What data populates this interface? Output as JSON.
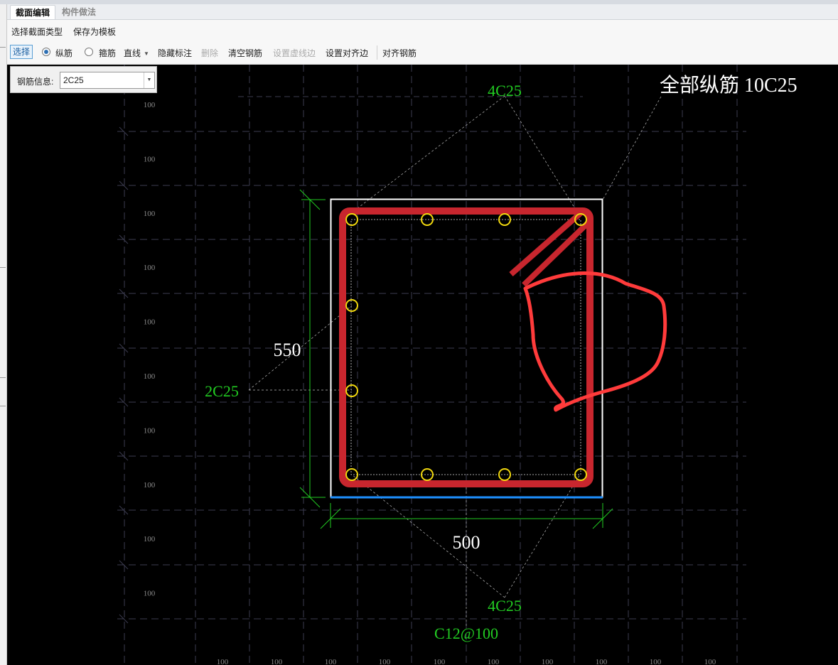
{
  "tabs": [
    {
      "label": "截面编辑",
      "active": true
    },
    {
      "label": "构件做法",
      "active": false
    }
  ],
  "menu": {
    "select_section_type": "选择截面类型",
    "save_as_template": "保存为模板"
  },
  "toolbar": {
    "select": "选择",
    "longitudinal": "纵筋",
    "stirrup": "箍筋",
    "mode": "直线",
    "hide_annotation": "隐藏标注",
    "delete": "删除",
    "clear_rebar": "清空钢筋",
    "set_dashed_edge": "设置虚线边",
    "set_align_edge": "设置对齐边",
    "align_rebar": "对齐钢筋",
    "rebar_mode_selected": "longitudinal"
  },
  "rebar_info": {
    "label": "钢筋信息:",
    "value": "2C25"
  },
  "drawing": {
    "total_longitudinal": "全部纵筋 10C25",
    "top_bars": "4C25",
    "bottom_bars": "4C25",
    "side_bars": "2C25",
    "stirrup": "C12@100",
    "height_dim": "550",
    "width_dim": "500",
    "grid_label": "100",
    "colors": {
      "background": "#000000",
      "grid": "#3c3c50",
      "section_outline": "#ffffff",
      "stirrup": "#c8262e",
      "rebar": "#f1d80e",
      "dimension": "#22cc22",
      "annotation": "#22cc22",
      "markup": "#ff3b3b",
      "align_edge": "#1e90ff"
    }
  }
}
